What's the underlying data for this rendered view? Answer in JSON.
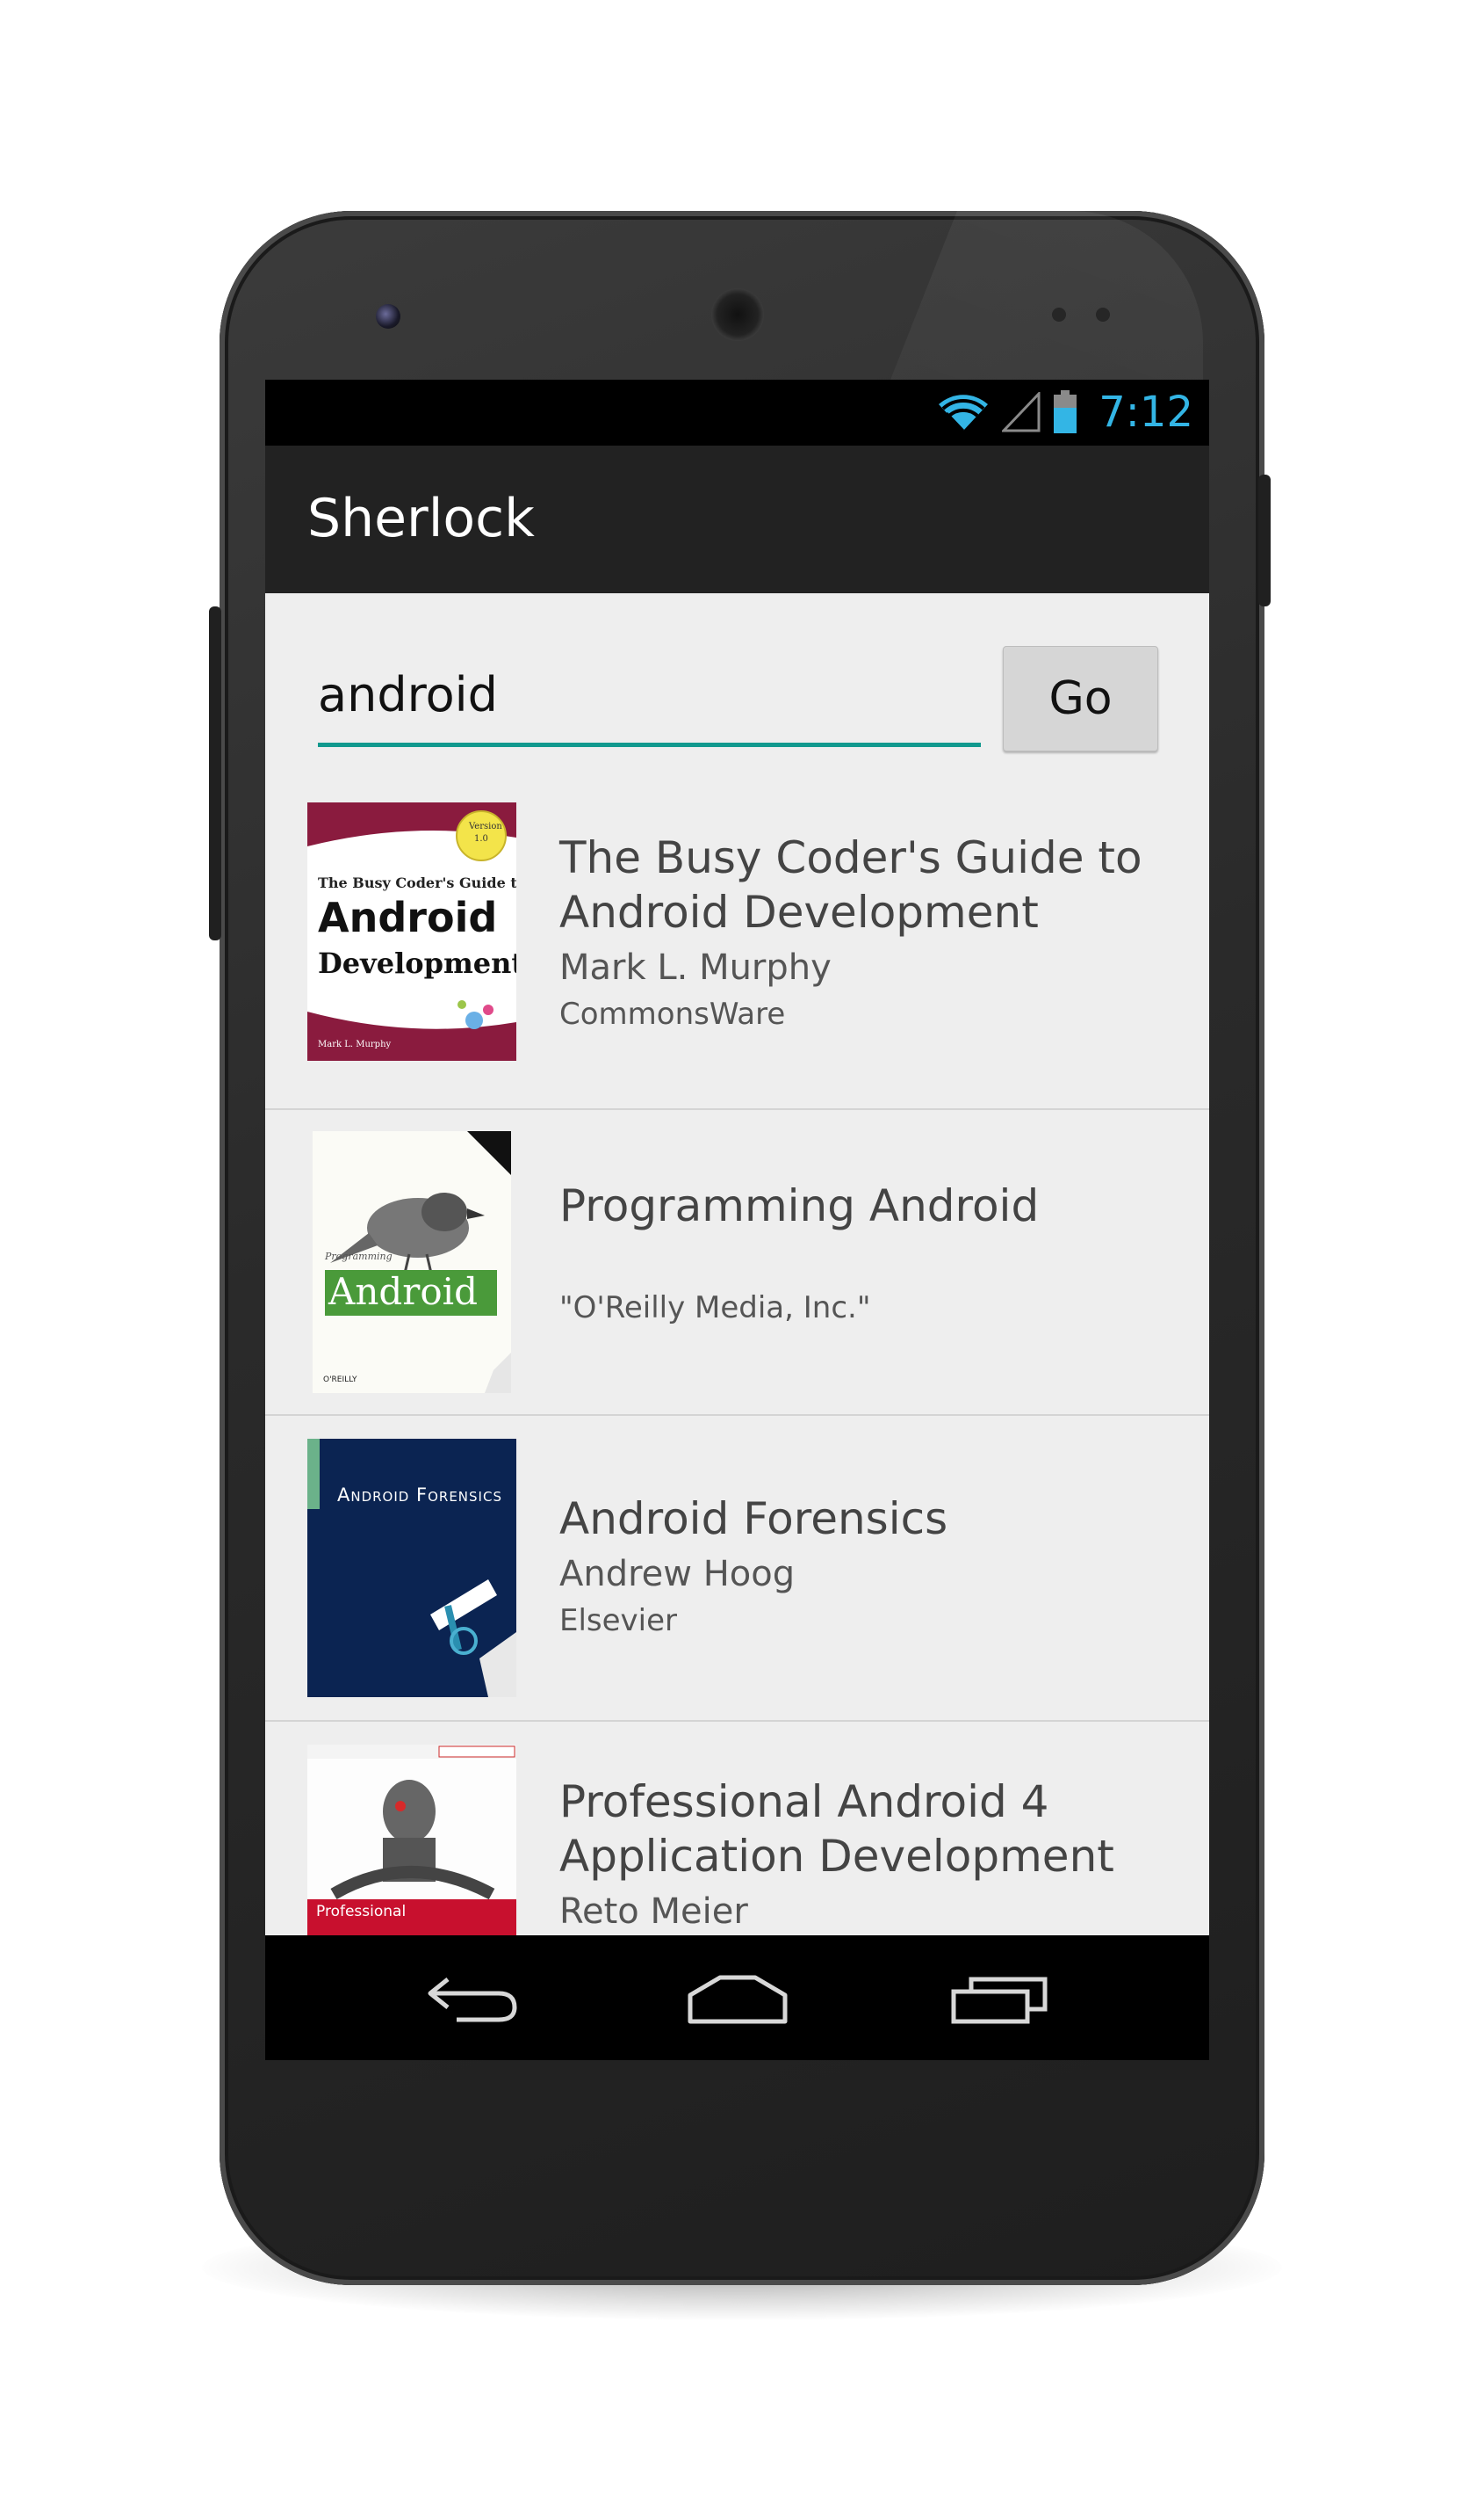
{
  "status_bar": {
    "time": "7:12",
    "icons": [
      "wifi-icon",
      "cell-signal-icon",
      "battery-icon"
    ]
  },
  "action_bar": {
    "title": "Sherlock"
  },
  "search": {
    "value": "android",
    "button_label": "Go"
  },
  "colors": {
    "accent": "#11998e",
    "clock": "#33b5e5",
    "action_bar": "#222222",
    "content_bg": "#eeeeee"
  },
  "books": [
    {
      "title": "The Busy Coder's Guide to Android Development",
      "author": "Mark L. Murphy",
      "publisher": "CommonsWare",
      "cover": {
        "badge_top": "Version",
        "badge_bottom": "1.0",
        "line1": "The Busy Coder's Guide to",
        "line2": "Android",
        "line3": "Development",
        "footer": "Mark L. Murphy"
      }
    },
    {
      "title": "Programming Android",
      "author": "",
      "publisher": "\"O'Reilly Media, Inc.\"",
      "cover": {
        "small": "Programming",
        "big": "Android",
        "footer": "O'REILLY"
      }
    },
    {
      "title": "Android Forensics",
      "author": "Andrew Hoog",
      "publisher": "Elsevier",
      "cover": {
        "heading": "Android Forensics"
      }
    },
    {
      "title": "Professional Android 4 Application Development",
      "author": "Reto Meier",
      "publisher": "",
      "cover": {
        "small": "Professional"
      }
    }
  ],
  "nav_bar": {
    "buttons": [
      "back-icon",
      "home-icon",
      "recents-icon"
    ]
  }
}
